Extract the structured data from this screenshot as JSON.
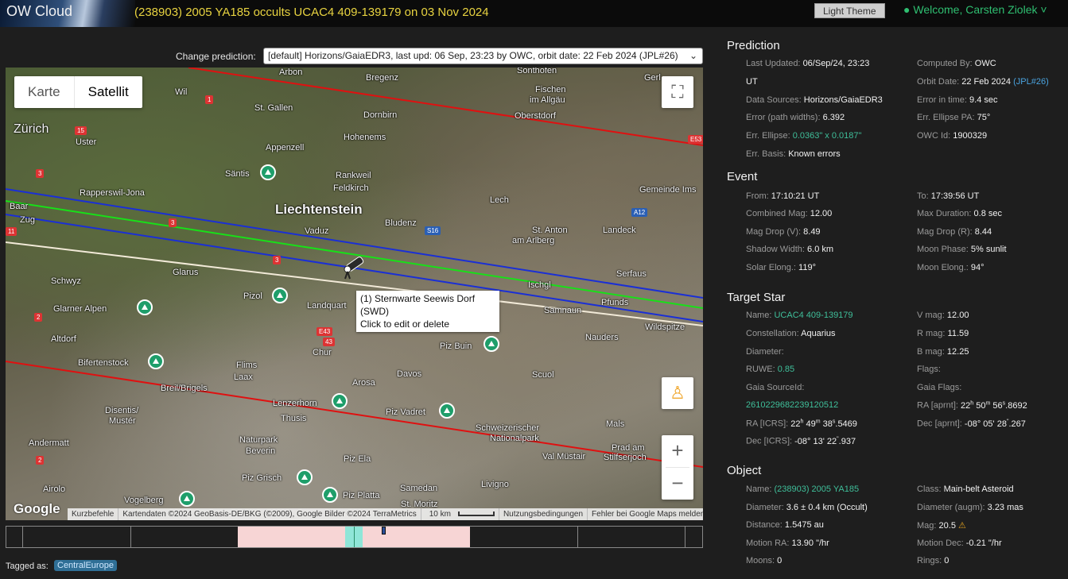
{
  "header": {
    "logo": "OW Cloud",
    "title": "(238903) 2005 YA185 occults UCAC4 409-139179 on 03 Nov 2024",
    "theme_button": "Light Theme",
    "welcome": "Welcome, Carsten Ziolek",
    "colors": {
      "title": "#e8d340",
      "welcome": "#2fbf71"
    }
  },
  "prediction_select": {
    "label": "Change prediction:",
    "selected": "[default] Horizons/GaiaEDR3, last upd: 06 Sep, 23:23 by OWC, orbit date: 22 Feb 2024 (JPL#26)"
  },
  "map": {
    "type_options": [
      "Karte",
      "Satellit"
    ],
    "active_type": "Satellit",
    "labels": {
      "arbon": "Arbon",
      "bregenz": "Bregenz",
      "sonthofen": "Sonthofen",
      "wil": "Wil",
      "fischen": "Fischen",
      "allgaeu": "im Allgäu",
      "stgallen": "St. Gallen",
      "dornbirn": "Dornbirn",
      "oberstdorf": "Oberstdorf",
      "zurich": "Zürich",
      "uster": "Uster",
      "hohenems": "Hohenems",
      "appenzell": "Appenzell",
      "rankweil": "Rankweil",
      "feldkirch": "Feldkirch",
      "santis": "Säntis",
      "rapperswil": "Rapperswil-Jona",
      "gemeinde": "Gemeinde Ims",
      "liechtenstein": "Liechtenstein",
      "lech": "Lech",
      "baar": "Baar",
      "zug": "Zug",
      "vaduz": "Vaduz",
      "bludenz": "Bludenz",
      "stanton": "St. Anton",
      "arlberg": "am Arlberg",
      "landeck": "Landeck",
      "glarus": "Glarus",
      "schwyz": "Schwyz",
      "pizol": "Pizol",
      "landquart": "Landquart",
      "ischgl": "Ischgl",
      "serfaus": "Serfaus",
      "pfunds": "Pfunds",
      "glarneralpen": "Glarner Alpen",
      "samnaun": "Samnaun",
      "wildspitze": "Wildspitze",
      "altdorf": "Altdorf",
      "nauders": "Nauders",
      "chur": "Chur",
      "pizbuin": "Piz Buin",
      "bifertenstock": "Bifertenstock",
      "flims": "Flims",
      "laax": "Laax",
      "davos": "Davos",
      "scuol": "Scuol",
      "arosa": "Arosa",
      "breilbrigels": "Breil/Brigels",
      "lenzerhorn": "Lenzerhorn",
      "disentis": "Disentis/",
      "muster": "Mustér",
      "thusis": "Thusis",
      "pizvadret": "Piz Vadret",
      "schweizerischer": "Schweizerischer",
      "nationalpark": "Nationalpark",
      "mals": "Mals",
      "andermatt": "Andermatt",
      "naturpark": "Naturpark",
      "beverin": "Beverin",
      "pradam": "Prad am",
      "stilfserjoch": "Stilfserjoch",
      "valmustair": "Val Müstair",
      "pizela": "Piz Ela",
      "airolo": "Airolo",
      "pizgrisch": "Piz Grisch",
      "livigno": "Livigno",
      "samedan": "Samedan",
      "pizplatta": "Piz Platta",
      "vogelberg": "Vogelberg",
      "stmoritz": "St. Moritz",
      "gerlos": "Gerl"
    },
    "shields": {
      "s1": "1",
      "s15": "15",
      "s3a": "3",
      "s3b": "3",
      "s3c": "3",
      "s11": "11",
      "s2": "2",
      "s2b": "2",
      "e53": "E53",
      "a12": "A12",
      "s16": "S16",
      "e43": "E43",
      "e43b": "43"
    },
    "tooltip": {
      "line1": "(1) Sternwarte Seewis Dorf (SWD)",
      "line2": "Click to edit or delete"
    },
    "google": "Google",
    "attribution": [
      "Kurzbefehle",
      "Kartendaten ©2024 GeoBasis-DE/BKG (©2009), Google Bilder ©2024 TerraMetrics",
      "10 km",
      "Nutzungsbedingungen",
      "Fehler bei Google Maps melden"
    ]
  },
  "tags": {
    "label": "Tagged as:",
    "items": [
      "CentralEurope"
    ]
  },
  "prediction": {
    "title": "Prediction",
    "last_updated_label": "Last Updated:",
    "last_updated": "06/Sep/24, 23:23",
    "last_updated_cont": "UT",
    "computed_by_label": "Computed By:",
    "computed_by": "OWC",
    "orbit_date_label": "Orbit Date:",
    "orbit_date": "22 Feb 2024",
    "orbit_jpl": "(JPL#26)",
    "data_sources_label": "Data Sources:",
    "data_sources": "Horizons/GaiaEDR3",
    "error_time_label": "Error in time:",
    "error_time": "9.4 sec",
    "error_path_label": "Error (path widths):",
    "error_path": "6.392",
    "err_ellipse_pa_label": "Err. Ellipse PA:",
    "err_ellipse_pa": "75°",
    "err_ellipse_label": "Err. Ellipse:",
    "err_ellipse": "0.0363\" x 0.0187\"",
    "owc_id_label": "OWC Id:",
    "owc_id": "1900329",
    "err_basis_label": "Err. Basis:",
    "err_basis": "Known errors"
  },
  "event": {
    "title": "Event",
    "from_label": "From:",
    "from": "17:10:21 UT",
    "to_label": "To:",
    "to": "17:39:56 UT",
    "combined_mag_label": "Combined Mag:",
    "combined_mag": "12.00",
    "max_duration_label": "Max Duration:",
    "max_duration": "0.8 sec",
    "mag_drop_v_label": "Mag Drop (V):",
    "mag_drop_v": "8.49",
    "mag_drop_r_label": "Mag Drop (R):",
    "mag_drop_r": "8.44",
    "shadow_width_label": "Shadow Width:",
    "shadow_width": "6.0 km",
    "moon_phase_label": "Moon Phase:",
    "moon_phase": "5% sunlit",
    "solar_elong_label": "Solar Elong.:",
    "solar_elong": "119°",
    "moon_elong_label": "Moon Elong.:",
    "moon_elong": "94°"
  },
  "target_star": {
    "title": "Target Star",
    "name_label": "Name:",
    "name": "UCAC4 409-139179",
    "vmag_label": "V mag:",
    "vmag": "12.00",
    "constellation_label": "Constellation:",
    "constellation": "Aquarius",
    "rmag_label": "R mag:",
    "rmag": "11.59",
    "diameter_label": "Diameter:",
    "bmag_label": "B mag:",
    "bmag": "12.25",
    "ruwe_label": "RUWE:",
    "ruwe": "0.85",
    "flags_label": "Flags:",
    "gaia_sourceid_label": "Gaia SourceId:",
    "gaia_sourceid": "2610229682239120512",
    "gaia_flags_label": "Gaia Flags:",
    "ra_aprnt_label": "RA [aprnt]:",
    "ra_aprnt": {
      "h": "22",
      "m": "50",
      "s": "56",
      "frac": "8692"
    },
    "ra_icrs_label": "RA [ICRS]:",
    "ra_icrs": {
      "h": "22",
      "m": "49",
      "s": "38",
      "frac": "5469"
    },
    "dec_aprnt_label": "Dec [aprnt]:",
    "dec_aprnt": {
      "d": "-08",
      "m": "05",
      "s": "28",
      "frac": "267"
    },
    "dec_icrs_label": "Dec [ICRS]:",
    "dec_icrs": {
      "d": "-08",
      "m": "13",
      "s": "22",
      "frac": "937"
    }
  },
  "object": {
    "title": "Object",
    "name_label": "Name:",
    "name": "(238903) 2005 YA185",
    "class_label": "Class:",
    "class": "Main-belt Asteroid",
    "diameter_label": "Diameter:",
    "diameter": "3.6 ± 0.4 km",
    "diameter_src": "(Occult)",
    "diameter_augm_label": "Diameter (augm):",
    "diameter_augm": "3.23 mas",
    "distance_label": "Distance:",
    "distance": "1.5475 au",
    "mag_label": "Mag:",
    "mag": "20.5",
    "motion_ra_label": "Motion RA:",
    "motion_ra": "13.90 \"/hr",
    "motion_dec_label": "Motion Dec:",
    "motion_dec": "-0.21 \"/hr",
    "moons_label": "Moons:",
    "moons": "0",
    "rings_label": "Rings:",
    "rings": "0"
  }
}
